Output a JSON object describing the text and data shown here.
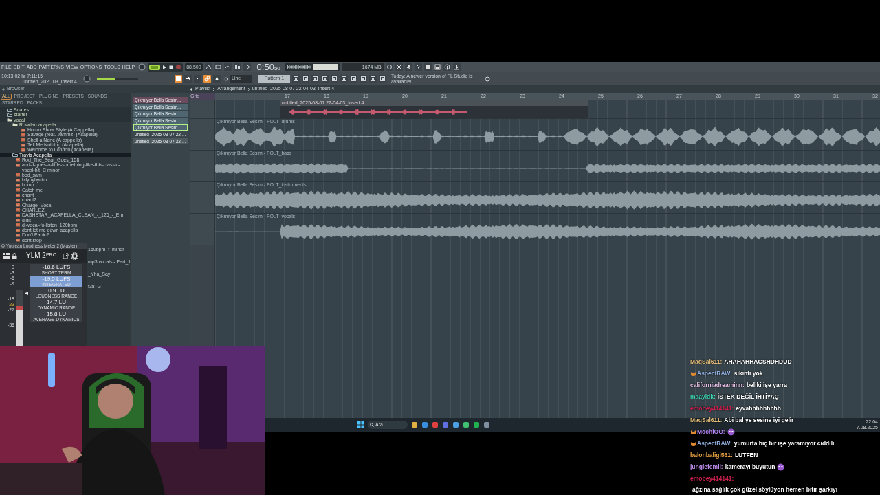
{
  "menu": [
    "FILE",
    "EDIT",
    "ADD",
    "PATTERNS",
    "VIEW",
    "OPTIONS",
    "TOOLS",
    "HELP"
  ],
  "toolbar": {
    "tempo": "88.500",
    "time": "0:50",
    "time_small": "50",
    "clock": "10:13:02 hr 7:11:15",
    "project": "untitled_202...03_Insert 4",
    "snap": "Line",
    "pattern": "Pattern 1",
    "hint": "Today: A newer version of FL Studio is available!",
    "memory": "1674 MB",
    "recording": false,
    "master_volume": {
      "level": 0.45
    }
  },
  "browser": {
    "title": "Browser",
    "tabs": [
      {
        "label": "ALL",
        "selected": true
      },
      {
        "label": "PROJECT",
        "selected": false
      },
      {
        "label": "PLUGINS",
        "selected": false
      },
      {
        "label": "PRESETS",
        "selected": false
      },
      {
        "label": "SOUNDS",
        "selected": false
      },
      {
        "label": "STARRED",
        "selected": false
      },
      {
        "label": "PACKS",
        "selected": false
      }
    ],
    "tree": [
      {
        "kind": "folder",
        "name": "Snares",
        "expanded": false,
        "selected": false
      },
      {
        "kind": "folder",
        "name": "starter",
        "expanded": false,
        "selected": false
      },
      {
        "kind": "folder",
        "name": "vocal",
        "expanded": true,
        "selected": false,
        "children": [
          {
            "kind": "folder",
            "name": "Rowdan acapella",
            "expanded": true,
            "selected": false,
            "children": [
              {
                "kind": "file",
                "name": "Horror Show Style (A Cappella)",
                "selected": false
              },
              {
                "kind": "file",
                "name": "Savage (feat. Jammz) (Acapella)",
                "selected": false
              },
              {
                "kind": "file",
                "name": "Shell a Nene (A cappella)",
                "selected": false
              },
              {
                "kind": "file",
                "name": "Tell Me Nothing (Acapella)",
                "selected": false
              },
              {
                "kind": "file",
                "name": "Welcome to London (Acapella)",
                "selected": false
              }
            ]
          },
          {
            "kind": "folder",
            "name": "Travis Acapella",
            "expanded": false,
            "selected": true
          },
          {
            "kind": "file",
            "name": "Rod_The_Beat_Goes_158",
            "selected": false
          },
          {
            "kind": "file",
            "name": "and-it-goes-a-little-something-like-this-classic-vocal-hit_C minor",
            "selected": false
          },
          {
            "kind": "file",
            "name": "bod_sam",
            "selected": false
          },
          {
            "kind": "file",
            "name": "bilybybycim",
            "selected": false
          },
          {
            "kind": "file",
            "name": "bomp",
            "selected": false
          },
          {
            "kind": "file",
            "name": "Catch me",
            "selected": false
          },
          {
            "kind": "file",
            "name": "chant",
            "selected": false
          },
          {
            "kind": "file",
            "name": "chant2",
            "selected": false
          },
          {
            "kind": "file",
            "name": "Charge_Vocal",
            "selected": false
          },
          {
            "kind": "file",
            "name": "CHARLEZ",
            "selected": false
          },
          {
            "kind": "file",
            "name": "DASHSTAR_ACAPELLA_CLEAN_-_126_-_Em",
            "selected": false
          },
          {
            "kind": "file",
            "name": "didit",
            "selected": false
          },
          {
            "kind": "file",
            "name": "dj-vocal-fo-listen_120bpm",
            "selected": false
          },
          {
            "kind": "file",
            "name": "dont let me down acapella",
            "selected": false
          },
          {
            "kind": "file",
            "name": "Don't Panic2",
            "selected": false
          },
          {
            "kind": "file",
            "name": "dont stop",
            "selected": false
          }
        ]
      }
    ],
    "cut_rows": [
      "150bpm_f_minor",
      "mp3 vocals - Part_1",
      "_Yha_Say",
      "f38_G"
    ]
  },
  "picker": [
    {
      "name": "Çıkmıyor Bella Sesim...",
      "color": "#6a4a5c",
      "selected": false
    },
    {
      "name": "Çıkmıyor Bella Sesim...",
      "color": "#4f6670",
      "selected": false
    },
    {
      "name": "Çıkmıyor Bella Sesim...",
      "color": "#4f6670",
      "selected": false
    },
    {
      "name": "Çıkmıyor Bella Sesim...",
      "color": "#4f6670",
      "selected": false
    },
    {
      "name": "Çıkmıyor Bella Sesim...",
      "color": "#4f6670",
      "selected": true
    },
    {
      "name": "untitled_2025-08-07 22-...",
      "color": "#3b474d",
      "selected": false
    },
    {
      "name": "untitled_2025-08-07 22-...",
      "color": "#4f5a60",
      "selected": false
    }
  ],
  "breadcrumb": [
    "Playlist",
    "Arrangement",
    "untitled_2025-08-07 22-04-03_Insert 4"
  ],
  "playlist": {
    "header": "Grid",
    "ruler": [
      "17",
      "18",
      "19",
      "20",
      "21",
      "22",
      "23",
      "24",
      "25",
      "26",
      "27",
      "28",
      "29",
      "30",
      "31",
      "32"
    ],
    "tracks": [
      {
        "kind": "pattern",
        "clip": "untitled_2025-08-07 22-04-03_Insert 4"
      },
      {
        "kind": "audio",
        "clip": "Çıkmıyor Bella Sesim - FOLT_drums"
      },
      {
        "kind": "audio",
        "clip": "Çıkmıyor Bella Sesim - FOLT_bass"
      },
      {
        "kind": "audio",
        "clip": "Çıkmıyor Bella Sesim - FOLT_instruments"
      },
      {
        "kind": "audio",
        "clip": "Çıkmıyor Bella Sesim - FOLT_vocals"
      }
    ]
  },
  "meter": {
    "title": "Youlean Loudness Meter 2 (Master)",
    "name": "YLM 2",
    "edition": "PRO",
    "scale": [
      "0",
      "-3",
      "-6",
      "-9",
      "-18",
      "-23",
      "-27",
      "-36"
    ],
    "level": 0.72,
    "readings": [
      {
        "value": "-18.6 LUFS",
        "label": "SHORT TERM",
        "selected": false
      },
      {
        "value": "-19.5 LUFS",
        "label": "INTEGRATED",
        "selected": true
      },
      {
        "value": "0.9 LU",
        "label": "LOUDNESS RANGE",
        "selected": false
      },
      {
        "value": "14.7 LU",
        "label": "DYNAMIC RANGE",
        "selected": false
      },
      {
        "value": "15.8 LU",
        "label": "AVERAGE DYNAMICS",
        "selected": false
      }
    ]
  },
  "taskbar": {
    "search": "Ara",
    "time": "22:04",
    "date": "7.08.2025"
  },
  "chat": [
    {
      "user": "MaqSal611:",
      "color": "#e2bd7c",
      "badge": false,
      "emote": false,
      "text": "AHAHAHHAGSHDHDUD"
    },
    {
      "user": "AspectRAW:",
      "color": "#8fb0e0",
      "badge": true,
      "emote": false,
      "text": "sıkıntı yok"
    },
    {
      "user": "californiadreaminn:",
      "color": "#e6bfe6",
      "badge": false,
      "emote": false,
      "text": "beliki işe yarra"
    },
    {
      "user": "maayidk:",
      "color": "#3fd0b0",
      "badge": false,
      "emote": false,
      "text": "İSTEK DEĞİL İHTİYAÇ"
    },
    {
      "user": "emobey414141:",
      "color": "#d0204f",
      "badge": false,
      "emote": false,
      "text": "eyvahhhhhhhhh"
    },
    {
      "user": "MaqSal611:",
      "color": "#e2bd7c",
      "badge": false,
      "emote": false,
      "text": "Abi bal ye sesine iyi gelir"
    },
    {
      "user": "MochiOO:",
      "color": "#b080f0",
      "badge": true,
      "emote": true
    },
    {
      "user": "AspectRAW:",
      "color": "#8fb0e0",
      "badge": true,
      "emote": false,
      "text": "yumurta hiç bir işe yaramıyor ciddili"
    },
    {
      "user": "balonbaligi561:",
      "color": "#e8a040",
      "badge": false,
      "emote": false,
      "text": "LÜTFEN"
    },
    {
      "user": "junglefemii:",
      "color": "#c090f0",
      "badge": false,
      "emote": true,
      "text": "kamerayı buyutun"
    },
    {
      "user": "emobey414141:",
      "color": "#d0204f",
      "badge": false,
      "emote": false,
      "text": "ağzına sağlık çok güzel söylüyon hemen bitir şarkıyı"
    }
  ]
}
